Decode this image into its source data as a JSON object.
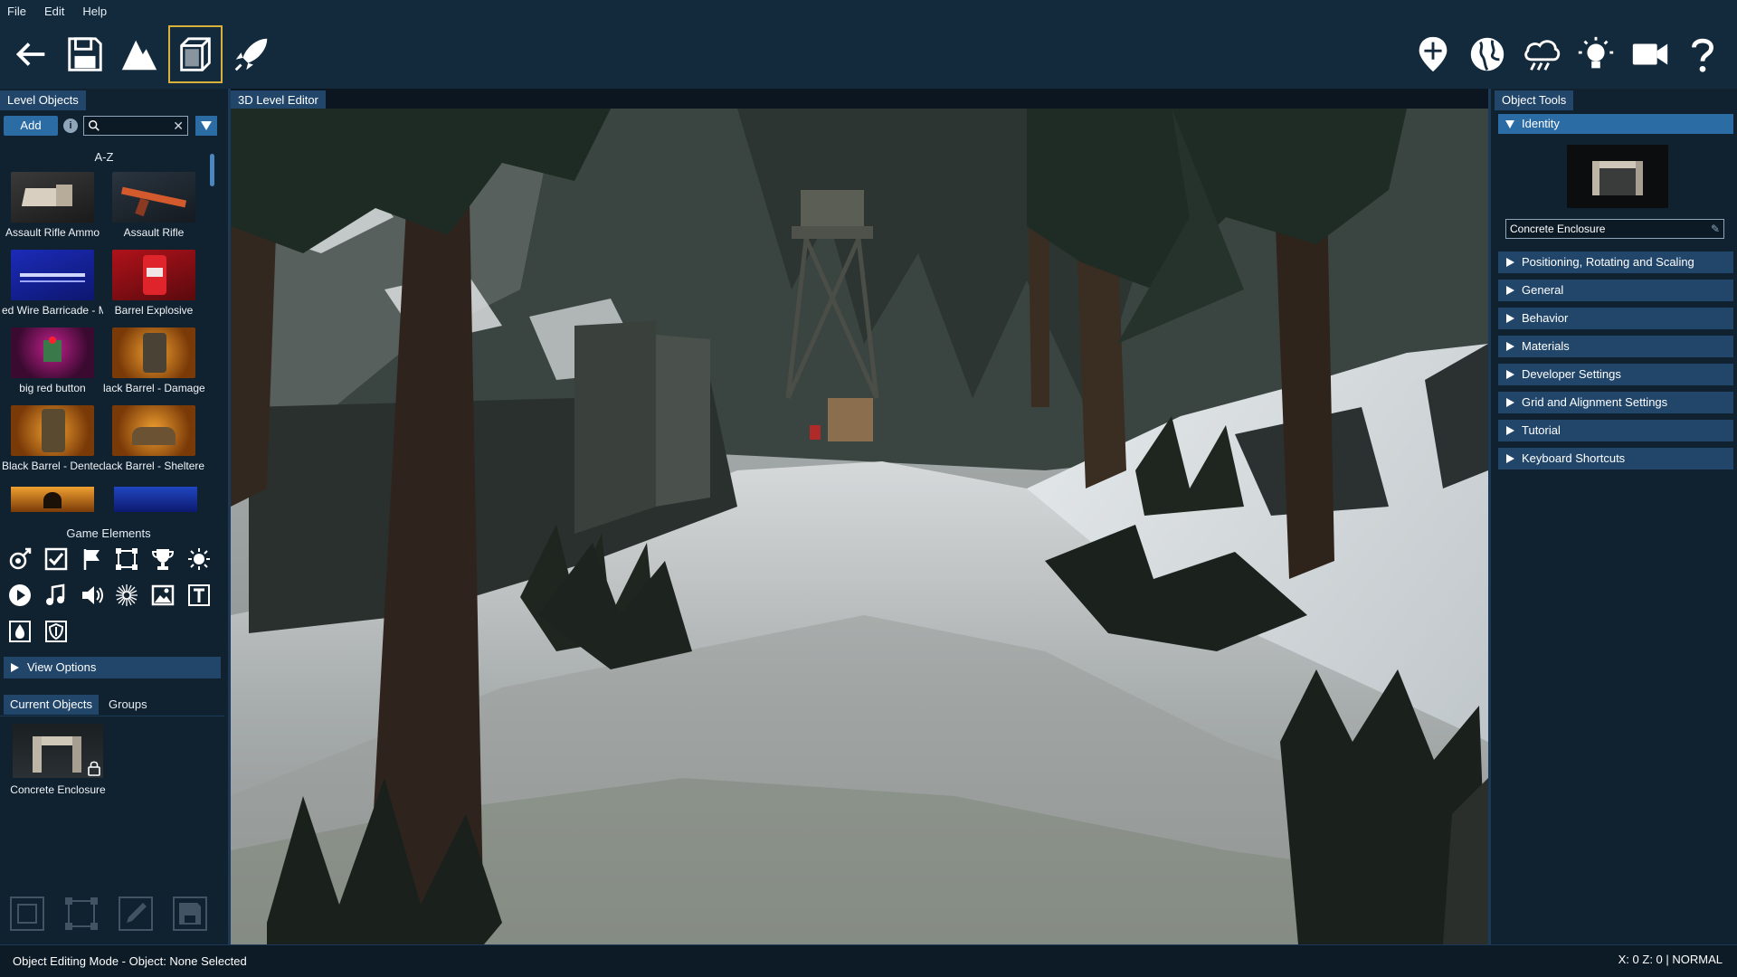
{
  "menu": [
    "File",
    "Edit",
    "Help"
  ],
  "panels": {
    "left_title": "Level Objects",
    "center_title": "3D Level Editor",
    "right_title": "Object Tools"
  },
  "left": {
    "add_label": "Add",
    "search_placeholder": "",
    "az_heading": "A-Z",
    "objects": [
      {
        "label": "Assault Rifle Ammo"
      },
      {
        "label": "Assault Rifle"
      },
      {
        "label": "ed Wire Barricade - Me"
      },
      {
        "label": "Barrel Explosive"
      },
      {
        "label": "big red button"
      },
      {
        "label": "lack Barrel - Damage"
      },
      {
        "label": "Black Barrel - Dented"
      },
      {
        "label": "lack Barrel - Sheltere"
      }
    ],
    "game_elements_heading": "Game Elements",
    "view_options_label": "View Options",
    "tabs": {
      "current": "Current Objects",
      "groups": "Groups"
    },
    "current_object": "Concrete Enclosure"
  },
  "right": {
    "identity_label": "Identity",
    "object_name": "Concrete Enclosure",
    "sections": [
      "Positioning, Rotating and Scaling",
      "General",
      "Behavior",
      "Materials",
      "Developer Settings",
      "Grid and Alignment Settings",
      "Tutorial",
      "Keyboard Shortcuts"
    ]
  },
  "status": {
    "left": "Object Editing Mode -  Object: None Selected",
    "right": "X: 0 Z: 0 | NORMAL"
  },
  "colors": {
    "accent": "#2b6ca5",
    "panel_tab": "#21466a",
    "active_border": "#d8b13a",
    "background": "#10212f"
  }
}
